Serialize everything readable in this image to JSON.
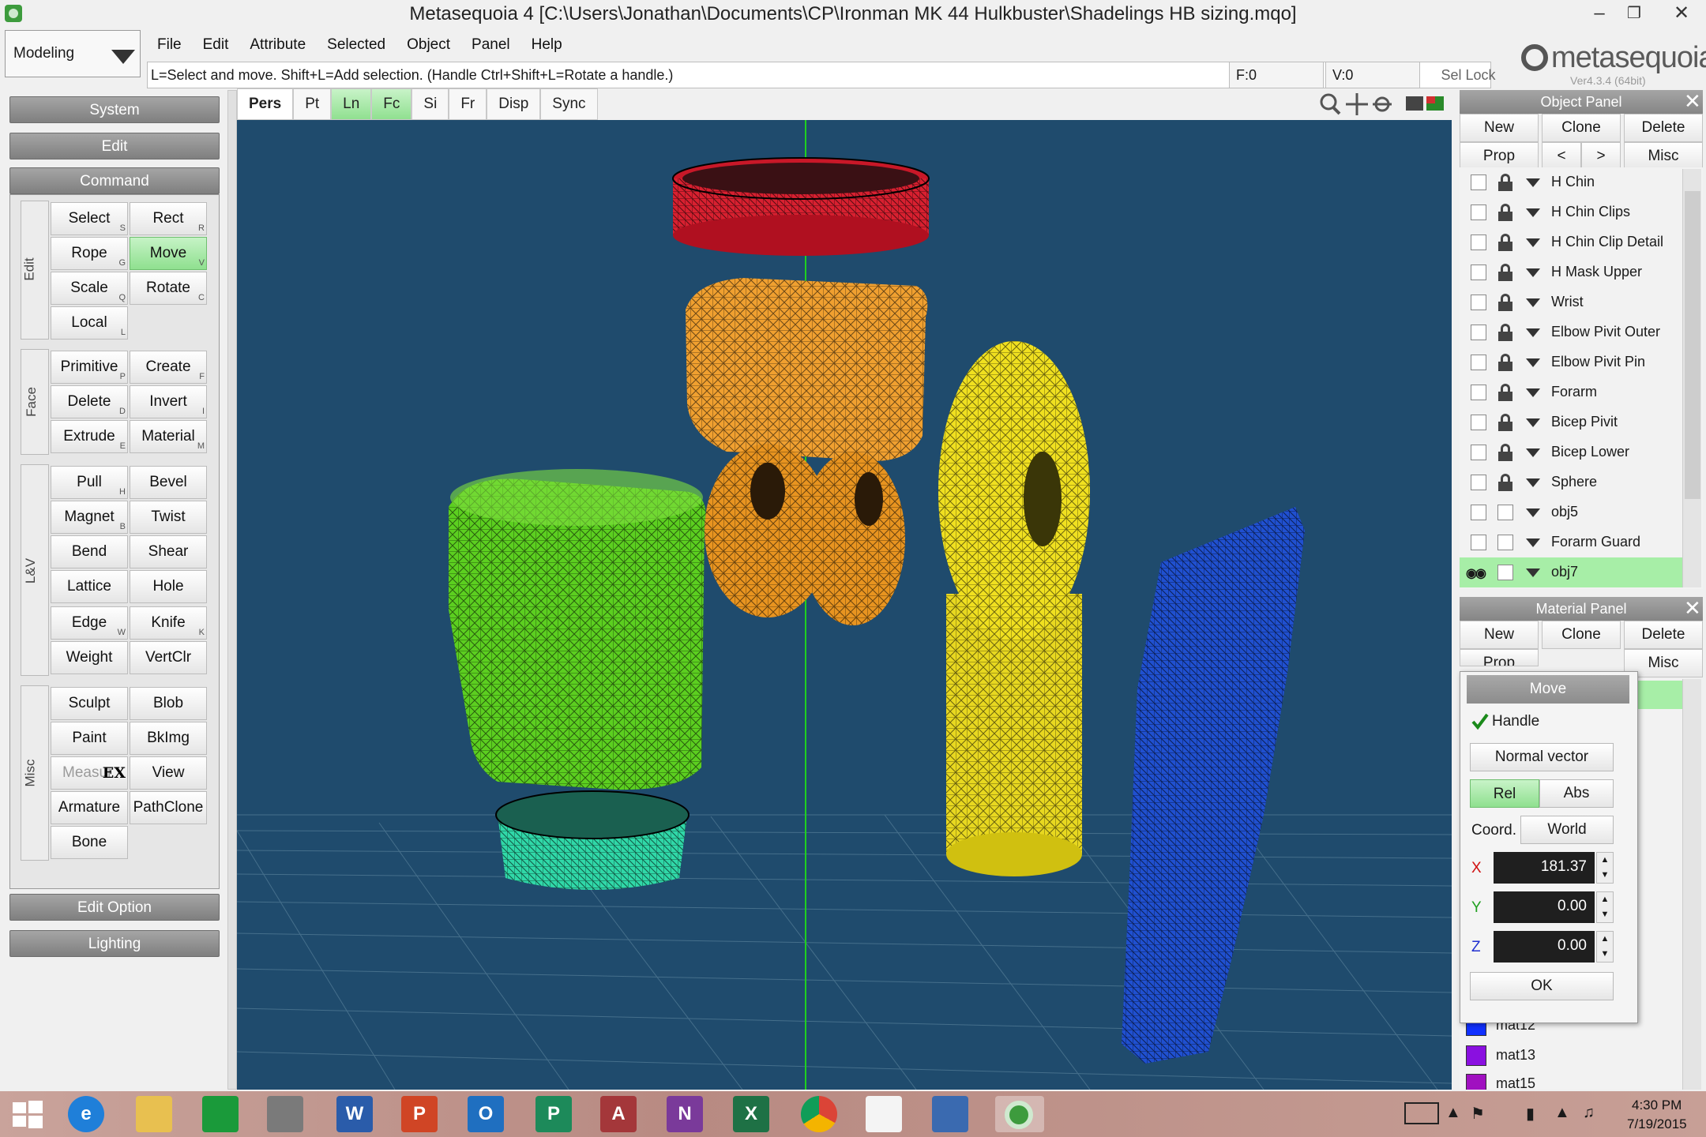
{
  "window": {
    "title": "Metasequoia 4 [C:\\Users\\Jonathan\\Documents\\CP\\Ironman MK 44 Hulkbuster\\Shadelings HB sizing.mqo]"
  },
  "mode": "Modeling",
  "menu": [
    "File",
    "Edit",
    "Attribute",
    "Selected",
    "Object",
    "Panel",
    "Help"
  ],
  "logo": {
    "text": "metasequoia",
    "version_digit": "4",
    "version": "Ver4.3.4 (64bit)"
  },
  "status": {
    "hint": "L=Select and move.  Shift+L=Add selection.  (Handle Ctrl+Shift+L=Rotate a handle.)",
    "faces": "F:0",
    "vertices": "V:0",
    "sel_lock": "Sel Lock"
  },
  "left_panel": {
    "system": "System",
    "edit": "Edit",
    "command": "Command",
    "edit_option": "Edit Option",
    "lighting": "Lighting",
    "groups": {
      "edit": "Edit",
      "face": "Face",
      "lv": "L&V",
      "misc": "Misc"
    },
    "buttons": {
      "select": {
        "label": "Select",
        "key": "S"
      },
      "rect": {
        "label": "Rect",
        "key": "R"
      },
      "rope": {
        "label": "Rope",
        "key": "G"
      },
      "move": {
        "label": "Move",
        "key": "V"
      },
      "scale": {
        "label": "Scale",
        "key": "Q"
      },
      "rotate": {
        "label": "Rotate",
        "key": "C"
      },
      "local": {
        "label": "Local",
        "key": "L"
      },
      "primitive": {
        "label": "Primitive",
        "key": "P"
      },
      "create": {
        "label": "Create",
        "key": "F"
      },
      "delete": {
        "label": "Delete",
        "key": "D"
      },
      "invert": {
        "label": "Invert",
        "key": "I"
      },
      "extrude": {
        "label": "Extrude",
        "key": "E"
      },
      "material": {
        "label": "Material",
        "key": "M"
      },
      "pull": {
        "label": "Pull",
        "key": "H"
      },
      "bevel": {
        "label": "Bevel",
        "key": ""
      },
      "magnet": {
        "label": "Magnet",
        "key": "B"
      },
      "twist": {
        "label": "Twist",
        "key": ""
      },
      "bend": {
        "label": "Bend",
        "key": ""
      },
      "shear": {
        "label": "Shear",
        "key": ""
      },
      "lattice": {
        "label": "Lattice",
        "key": ""
      },
      "hole": {
        "label": "Hole",
        "key": ""
      },
      "edge": {
        "label": "Edge",
        "key": "W"
      },
      "knife": {
        "label": "Knife",
        "key": "K"
      },
      "weight": {
        "label": "Weight",
        "key": ""
      },
      "vertclr": {
        "label": "VertClr",
        "key": ""
      },
      "sculpt": {
        "label": "Sculpt",
        "key": ""
      },
      "blob": {
        "label": "Blob",
        "key": ""
      },
      "paint": {
        "label": "Paint",
        "key": ""
      },
      "bkimg": {
        "label": "BkImg",
        "key": ""
      },
      "measure": {
        "label": "Measur",
        "badge": "EX"
      },
      "view": {
        "label": "View",
        "key": ""
      },
      "armature": {
        "label": "Armature",
        "key": ""
      },
      "pathclone": {
        "label": "PathClone",
        "key": ""
      },
      "bone": {
        "label": "Bone",
        "key": ""
      }
    }
  },
  "view_toolbar": [
    "Pers",
    "Pt",
    "Ln",
    "Fc",
    "Si",
    "Fr",
    "Disp",
    "Sync"
  ],
  "object_panel": {
    "title": "Object Panel",
    "buttons": {
      "new": "New",
      "clone": "Clone",
      "delete": "Delete",
      "prop": "Prop",
      "prev": "<",
      "next": ">",
      "misc": "Misc"
    },
    "objects": [
      "H Chin",
      "H Chin Clips",
      "H Chin Clip Detail",
      "H Mask Upper",
      "Wrist",
      "Elbow Pivit Outer",
      "Elbow Pivit Pin",
      "Forarm",
      "Bicep Pivit",
      "Bicep Lower",
      "Sphere",
      "obj5",
      "Forarm Guard",
      "obj7"
    ]
  },
  "material_panel": {
    "title": "Material Panel",
    "buttons": {
      "new": "New",
      "clone": "Clone",
      "delete": "Delete",
      "prop": "Prop",
      "misc": "Misc"
    },
    "materials": [
      {
        "name": "mat12",
        "color": "#1030ff"
      },
      {
        "name": "mat13",
        "color": "#8a10e0"
      },
      {
        "name": "mat15",
        "color": "#a010c0"
      }
    ]
  },
  "move_dialog": {
    "title": "Move",
    "handle": "Handle",
    "handle_checked": true,
    "normal_vector": "Normal vector",
    "rel": "Rel",
    "abs": "Abs",
    "coord_label": "Coord.",
    "coord_value": "World",
    "x_label": "X",
    "x": "181.37",
    "y_label": "Y",
    "y": "0.00",
    "z_label": "Z",
    "z": "0.00",
    "ok": "OK"
  },
  "taskbar": {
    "time": "4:30 PM",
    "date": "7/19/2015"
  },
  "colors": {
    "viewport_bg": "#1f4b6d",
    "active_green": "#90e090",
    "red_part": "#e02030",
    "orange_part": "#f0a030",
    "yellow_part": "#f0e020",
    "green_part": "#5ccf20",
    "teal_part": "#30d8a8",
    "blue_part": "#2050d0"
  }
}
